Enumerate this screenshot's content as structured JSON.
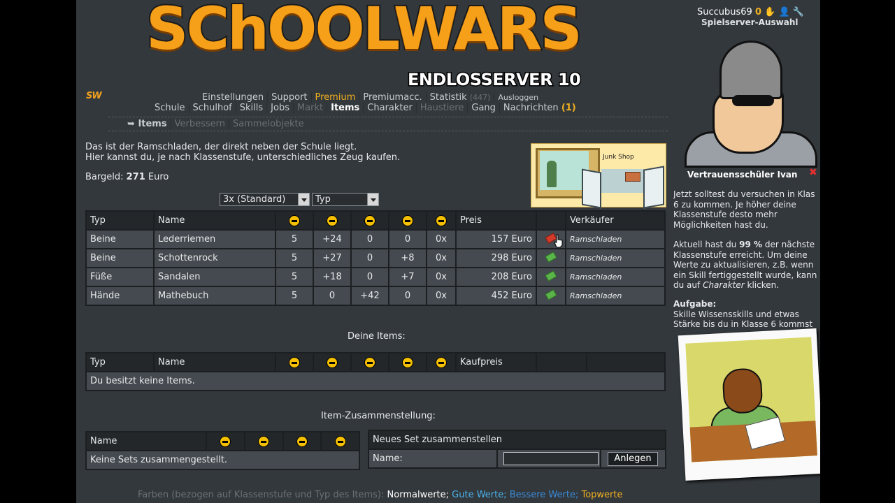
{
  "header": {
    "logo_text": "SChOOLWARS",
    "server": "ENDLOSSERVER 10",
    "badge": "SW"
  },
  "user": {
    "name": "Succubus69",
    "count": "0",
    "server_select": "Spielserver-Auswahl"
  },
  "nav_top": [
    {
      "label": "Einstellungen"
    },
    {
      "label": "Support"
    },
    {
      "label": "Premium"
    },
    {
      "label": "Premiumacc."
    },
    {
      "label": "Statistik"
    },
    {
      "label": "(447)"
    },
    {
      "label": "Ausloggen"
    }
  ],
  "nav_main": [
    {
      "label": "Schule"
    },
    {
      "label": "Schulhof"
    },
    {
      "label": "Skills"
    },
    {
      "label": "Jobs"
    },
    {
      "label": "Markt"
    },
    {
      "label": "Items"
    },
    {
      "label": "Charakter"
    },
    {
      "label": "Haustiere"
    },
    {
      "label": "Gang"
    },
    {
      "label": "Nachrichten"
    },
    {
      "label": "(1)"
    }
  ],
  "nav_sub": [
    {
      "label": "Items"
    },
    {
      "label": "Verbessern"
    },
    {
      "label": "Sammelobjekte"
    }
  ],
  "intro": {
    "line1": "Das ist der Ramschladen, der direkt neben der Schule liegt.",
    "line2": "Hier kannst du, je nach Klassenstufe, unterschiedliches Zeug kaufen.",
    "cash_label": "Bargeld:",
    "cash_value": "271",
    "cash_unit": "Euro"
  },
  "shop_image": {
    "sign": "Junk Shop"
  },
  "filters": {
    "quantity": "3x (Standard)",
    "type": "Typ"
  },
  "shop_table": {
    "headers": {
      "typ": "Typ",
      "name": "Name",
      "preis": "Preis",
      "verkaeufer": "Verkäufer"
    },
    "rows": [
      {
        "typ": "Beine",
        "name": "Lederriemen",
        "s1": "5",
        "s2": "+24",
        "s3": "0",
        "s4": "0",
        "s5": "0x",
        "preis": "157 Euro",
        "seller": "Ramschladen"
      },
      {
        "typ": "Beine",
        "name": "Schottenrock",
        "s1": "5",
        "s2": "+27",
        "s3": "0",
        "s4": "+8",
        "s5": "0x",
        "preis": "298 Euro",
        "seller": "Ramschladen"
      },
      {
        "typ": "Füße",
        "name": "Sandalen",
        "s1": "5",
        "s2": "+18",
        "s3": "0",
        "s4": "+7",
        "s5": "0x",
        "preis": "208 Euro",
        "seller": "Ramschladen"
      },
      {
        "typ": "Hände",
        "name": "Mathebuch",
        "s1": "5",
        "s2": "0",
        "s3": "+42",
        "s4": "0",
        "s5": "0x",
        "preis": "452 Euro",
        "seller": "Ramschladen"
      }
    ]
  },
  "my_items": {
    "title": "Deine Items:",
    "headers": {
      "typ": "Typ",
      "name": "Name",
      "kaufpreis": "Kaufpreis"
    },
    "empty": "Du besitzt keine Items."
  },
  "sets": {
    "title": "Item-Zusammenstellung:",
    "header_name": "Name",
    "empty": "Keine Sets zusammengestellt.",
    "new_title": "Neues Set zusammenstellen",
    "name_label": "Name:",
    "button": "Anlegen"
  },
  "ivan": {
    "title": "Vertrauensschüler Ivan",
    "close": "✖",
    "p1": [
      "Jetzt solltest du versuchen in Klas",
      "6 zu kommen. Je höher deine",
      "Klassenstufe desto mehr",
      "Möglichkeiten hast du."
    ],
    "p2_a": "Aktuell hast du",
    "p2_pct": "99 %",
    "p2_b": "der nächste",
    "p2": [
      "Klassenstufe erreicht. Um deine",
      "Werte zu aktualisieren, z.B. wenn",
      "ein Skill fertiggestellt wurde, kann"
    ],
    "p2_end_a": "du auf",
    "p2_end_link": "Charakter",
    "p2_end_b": "klicken.",
    "task_title": "Aufgabe:",
    "task": [
      "Skille Wissensskills und etwas",
      "Stärke bis du in Klasse 6 kommst"
    ]
  },
  "footer": {
    "prefix": "Farben (bezogen auf Klassenstufe und Typ des Items):",
    "normal": "Normalwerte;",
    "gut": "Gute Werte;",
    "besser": "Bessere Werte;",
    "top": "Topwerte"
  },
  "colors": {
    "accent": "#f0b020",
    "background": "#33383c",
    "good": "#4ab0e8",
    "better": "#3a8ad8"
  }
}
